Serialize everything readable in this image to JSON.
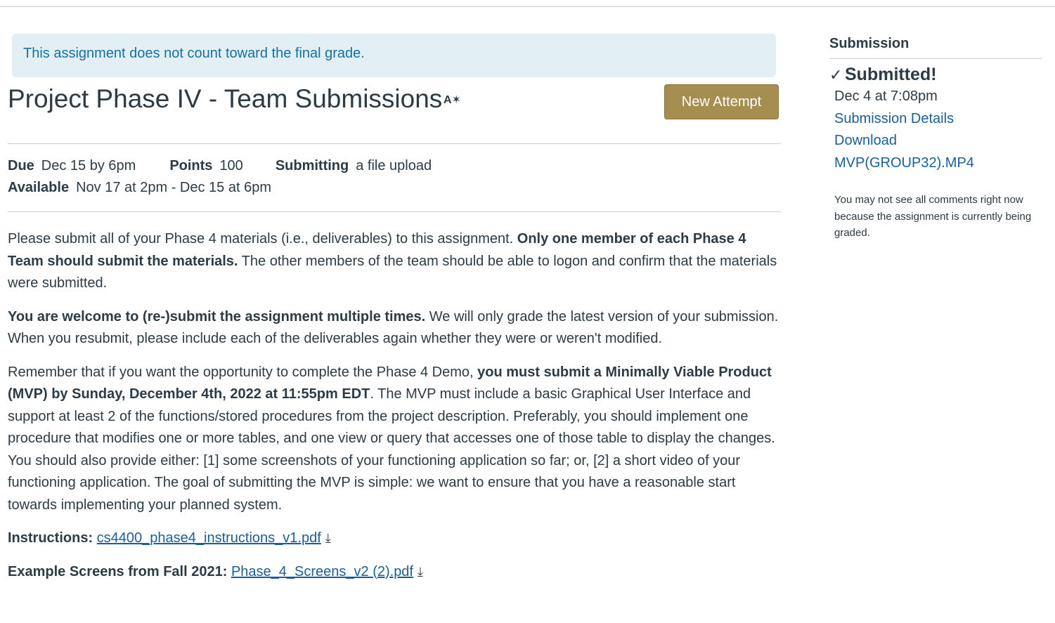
{
  "notice": "This assignment does not count toward the final grade.",
  "title": "Project Phase IV - Team Submissions",
  "ai_icon_glyph": "A✶",
  "new_attempt_label": "New Attempt",
  "details": {
    "due_label": "Due",
    "due_value": "Dec 15 by 6pm",
    "points_label": "Points",
    "points_value": "100",
    "submitting_label": "Submitting",
    "submitting_value": "a file upload",
    "available_label": "Available",
    "available_value": "Nov 17 at 2pm - Dec 15 at 6pm"
  },
  "description": {
    "p1_a": "Please submit all of your Phase 4 materials (i.e., deliverables) to this assignment. ",
    "p1_b": "Only one member of each Phase 4 Team should submit the materials.",
    "p1_c": "  The other members of the team should be able to logon and confirm that the materials were submitted.",
    "p2_a": "You are welcome to (re-)submit the assignment multiple times.",
    "p2_b": "  We will only grade the latest version of your submission.  When you resubmit, please include each of the deliverables again whether they were or weren't modified.",
    "p3_a": "Remember that if you want the opportunity to complete the Phase 4 Demo, ",
    "p3_b": "you must submit a Minimally Viable Product (MVP) by Sunday, December 4th, 2022 at 11:55pm EDT",
    "p3_c": ".  The MVP must include a basic Graphical User Interface and support at least 2 of the functions/stored procedures from the project description.  Preferably, you should implement one procedure that modifies one or more tables, and one view or query that accesses one of those table to display the changes.  You should also provide either: [1] some screenshots of your functioning application so far; or, [2] a short video of your functioning application.  The goal of submitting the MVP is simple: we want to ensure that you have a reasonable start towards implementing your planned system.",
    "instructions_label": "Instructions: ",
    "instructions_file": "cs4400_phase4_instructions_v1.pdf",
    "examples_label": "Example Screens from Fall 2021: ",
    "examples_file": "Phase_4_Screens_v2 (2).pdf"
  },
  "sidebar": {
    "header": "Submission",
    "status": "Submitted!",
    "date": "Dec 4 at 7:08pm",
    "details_link": "Submission Details",
    "download_link_1": "Download",
    "download_link_2": "MVP(GROUP32).MP4",
    "note": "You may not see all comments right now because the assignment is currently being graded."
  },
  "icons": {
    "check": "check-icon",
    "download": "download-icon",
    "ai": "immersive-reader-icon"
  }
}
